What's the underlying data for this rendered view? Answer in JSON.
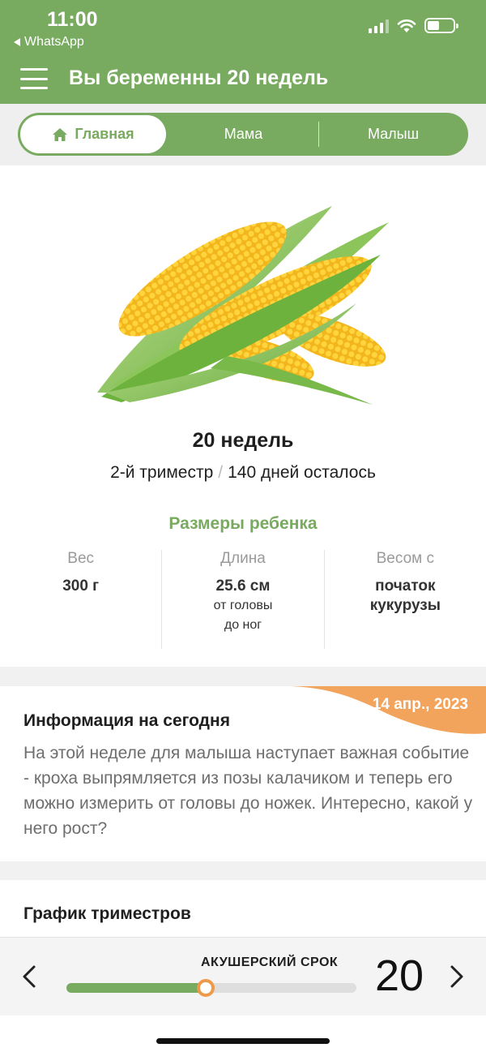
{
  "status": {
    "time": "11:00",
    "back_app": "WhatsApp"
  },
  "header": {
    "title": "Вы беременны 20 недель"
  },
  "tabs": [
    {
      "label": "Главная",
      "icon": "home-icon",
      "active": true
    },
    {
      "label": "Мама",
      "active": false
    },
    {
      "label": "Малыш",
      "active": false
    }
  ],
  "week_summary": {
    "weeks": "20 недель",
    "trimester": "2-й триместр",
    "separator": "/",
    "days_left": "140 дней осталось"
  },
  "baby_sizes": {
    "heading": "Размеры ребенка",
    "items": [
      {
        "label": "Вес",
        "value": "300 г",
        "sub": ""
      },
      {
        "label": "Длина",
        "value": "25.6 см",
        "sub": "от головы\nдо ног"
      },
      {
        "label": "Весом с",
        "value": "початок\nкукурузы",
        "sub": ""
      }
    ]
  },
  "today": {
    "date": "14 апр., 2023",
    "heading": "Информация на сегодня",
    "text": "На этой неделе для малыша наступает важная событие - кроха выпрямляется из позы калачиком и теперь его можно измерить от головы до ножек. Интересно, какой у него рост?"
  },
  "chart_section": {
    "heading": "График триместров"
  },
  "bottom_bar": {
    "label": "АКУШЕРСКИЙ СРОК",
    "week": "20",
    "progress": 0.48
  },
  "colors": {
    "green": "#78ab5f",
    "orange": "#ef9a4a",
    "orange_light": "#f3a45c"
  }
}
